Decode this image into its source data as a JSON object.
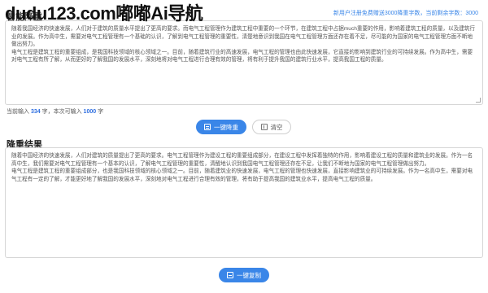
{
  "watermark": "dudu123.com嘟嘟Ai导航",
  "header": {
    "title": "智能降重",
    "note_prefix": "新用户注册免费赠送3000降重字数，当前剩余字数：",
    "note_count": "3000"
  },
  "input": {
    "paragraph1": "随着我国经济的快速发展，人们对于建筑的质量水平提出了更高的要求。而电气工程管理作为建筑工程中重要的一个环节，在建筑工程中占据much重要的作用，影响着建筑工程的质量，以及建筑行业的发展。作为高中生，需要对电气工程管理有一个基础的认识，了解到电气工程管理的重要性，清楚地意识到我国在电气工程管理方面还存在着不足，尽可能的为国家的电气工程管理方面不断地做出努力。",
    "paragraph2": "电气工程是建筑工程的重要组成，是我国科技领域的核心领域之一。目前，随着建筑行业的高速发展，电气工程的管理也由此快速发展，它直接的影响到建筑行业的可持续发展。作为高中生，需要对电气工程有所了解，从而更好的了解我国的发展水平，深刻地将对电气工程进行合理有效的管理，将有利于提升我国的建筑行业水平，提高我国工程的质量。"
  },
  "counter": {
    "prefix": "当前输入",
    "current": "334",
    "middle": "字，本次可输入",
    "limit": "1000",
    "suffix": "字"
  },
  "buttons": {
    "reduce_label": "一键降重",
    "clear_label": "清空",
    "copy_label": "一键复制"
  },
  "result": {
    "title": "降重结果",
    "paragraph1": "随着中国经济的快速发展，人们对建筑的质量提出了更高的要求。电气工程管理作为建设工程的重要组成部分，在建设工程中发挥着独特的作用，影响着建设工程的质量和建筑业的发展。作为一名高中生，我们需要对电气工程管理有一个基本的认识，了解电气工程管理的重要性，清醒地认识到我国电气工程管理还存在不足，让我们不断地为国家的电气工程管理做出努力。",
    "paragraph2": "电气工程是建筑工程的重要组成部分，也是我国科技领域的核心领域之一。目前，随着建筑业的快速发展，电气工程的管理也快速发展，直接影响建筑业的可持续发展。作为一名高中生，需要对电气工程有一定的了解，才能更好地了解我国的发展水平，深刻地对电气工程进行合理有效的管理，将有助于提高我国的建筑业水平，提高电气工程的质量。"
  }
}
